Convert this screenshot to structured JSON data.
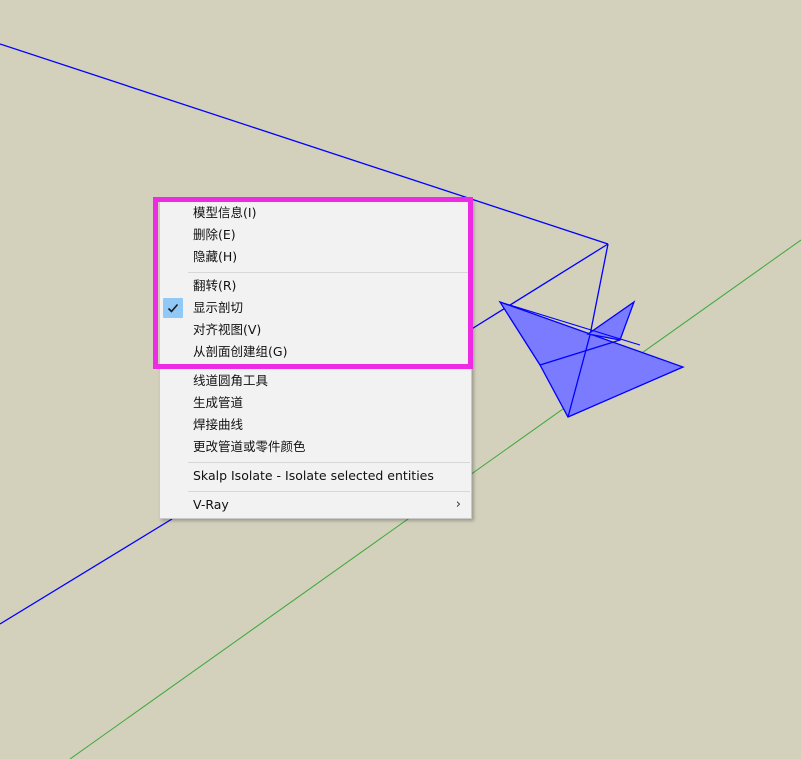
{
  "colors": {
    "viewport_bg": "#d3d0bc",
    "edge_blue": "#0000ff",
    "face_blue": "#7b7bff",
    "axis_green": "#3aa83a",
    "highlight": "#ee2be4",
    "check_bg": "#90c8f6"
  },
  "context_menu": {
    "items": [
      {
        "label": "模型信息(I)"
      },
      {
        "label": "删除(E)"
      },
      {
        "label": "隐藏(H)"
      },
      {
        "label": "翻转(R)"
      },
      {
        "label": "显示剖切",
        "checked": true
      },
      {
        "label": "对齐视图(V)"
      },
      {
        "label": "从剖面创建组(G)"
      },
      {
        "label": "线道圆角工具"
      },
      {
        "label": "生成管道"
      },
      {
        "label": "焊接曲线"
      },
      {
        "label": "更改管道或零件颜色"
      },
      {
        "label": "Skalp Isolate - Isolate selected entities"
      },
      {
        "label": "V-Ray",
        "submenu": true
      }
    ],
    "checkmark_icon": "checkmark-icon",
    "submenu_icon": "chevron-right-icon",
    "submenu_glyph": "›"
  }
}
